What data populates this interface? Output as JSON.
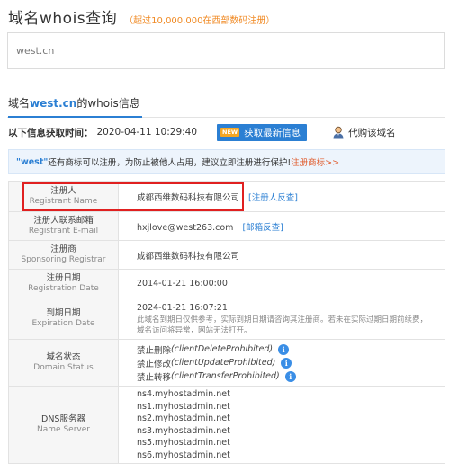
{
  "header": {
    "title": "域名whois查询",
    "note": "（超过10,000,000在西部数码注册）"
  },
  "search": {
    "value": "west.cn"
  },
  "tab": {
    "prefix": "域名",
    "domain": "west.cn",
    "suffix": "的whois信息"
  },
  "info_bar": {
    "label": "以下信息获取时间：",
    "timestamp": "2020-04-11 10:29:40",
    "new_badge": "NEW",
    "refresh_label": "获取最新信息",
    "buy_label": "代购该域名"
  },
  "notice": {
    "quoted": "\"west\"",
    "text": " 还有商标可以注册，为防止被他人占用，建议立即注册进行保护!",
    "link": "注册商标>>"
  },
  "rows": {
    "registrant": {
      "cn": "注册人",
      "en": "Registrant Name",
      "value": "成都西维数码科技有限公司",
      "link": "[注册人反查]"
    },
    "email": {
      "cn": "注册人联系邮箱",
      "en": "Registrant E-mail",
      "value": "hxjlove@west263.com",
      "link": "[邮箱反查]"
    },
    "registrar": {
      "cn": "注册商",
      "en": "Sponsoring Registrar",
      "value": "成都西维数码科技有限公司"
    },
    "reg_date": {
      "cn": "注册日期",
      "en": "Registration Date",
      "value": "2014-01-21 16:00:00"
    },
    "exp_date": {
      "cn": "到期日期",
      "en": "Expiration Date",
      "value": "2024-01-21 16:07:21",
      "note1": "此域名到期日仅供参考，实际到期日期请咨询其注册商。若未在实际过期日期前续费，",
      "note2": "域名访问将异常，网站无法打开。"
    },
    "status": {
      "cn": "域名状态",
      "en": "Domain Status",
      "items": [
        {
          "cn": "禁止删除",
          "code": "(clientDeleteProhibited)"
        },
        {
          "cn": "禁止修改",
          "code": "(clientUpdateProhibited)"
        },
        {
          "cn": "禁止转移",
          "code": "(clientTransferProhibited)"
        }
      ]
    },
    "dns": {
      "cn": "DNS服务器",
      "en": "Name Server",
      "servers": [
        "ns4.myhostadmin.net",
        "ns1.myhostadmin.net",
        "ns2.myhostadmin.net",
        "ns3.myhostadmin.net",
        "ns5.myhostadmin.net",
        "ns6.myhostadmin.net"
      ]
    }
  },
  "colors": {
    "accent": "#2b7fd3",
    "orange": "#f08a24",
    "highlight": "#e02020"
  }
}
